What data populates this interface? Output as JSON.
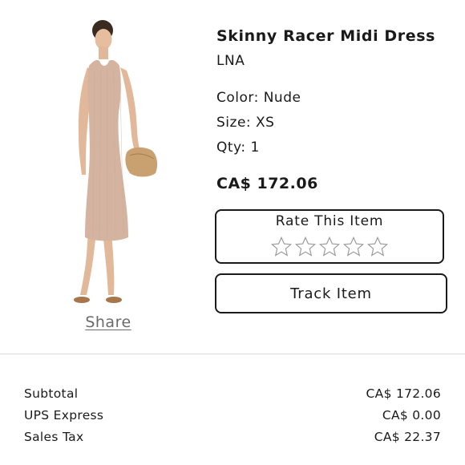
{
  "product": {
    "title": "Skinny Racer Midi Dress",
    "brand": "LNA",
    "color": "Color: Nude",
    "size": "Size: XS",
    "qty": "Qty: 1",
    "price": "CA$ 172.06",
    "share_label": "Share"
  },
  "rating": {
    "title": "Rate This Item",
    "max_stars": 5,
    "current": 0
  },
  "actions": {
    "track_label": "Track Item"
  },
  "summary": {
    "rows": [
      {
        "label": "Subtotal",
        "value": "CA$ 172.06"
      },
      {
        "label": "UPS Express",
        "value": "CA$ 0.00"
      },
      {
        "label": "Sales Tax",
        "value": "CA$ 22.37"
      }
    ]
  },
  "colors": {
    "text": "#1a1a1a",
    "muted": "#6b6b6b",
    "divider": "#dddddd",
    "dress": "#d4b4a0",
    "skin": "#e2b89a",
    "clutch": "#c9a070"
  },
  "icons": {
    "star": "star-outline-icon"
  }
}
